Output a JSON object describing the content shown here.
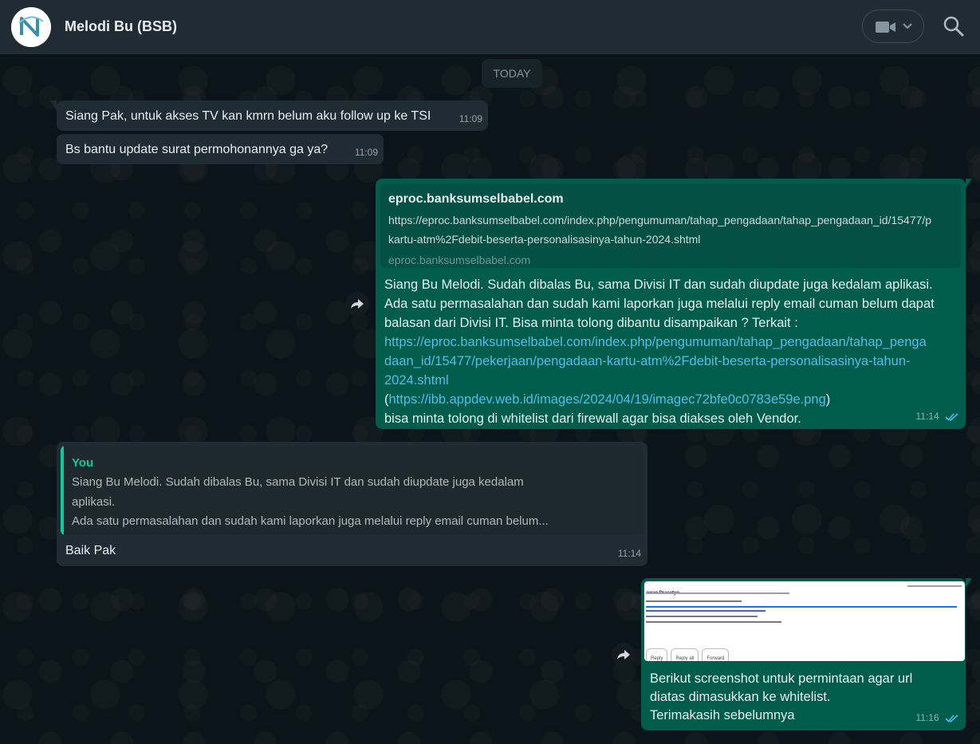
{
  "header": {
    "contact_name": "Melodi Bu (BSB)",
    "avatar_letter": "N"
  },
  "day_divider": "TODAY",
  "messages": [
    {
      "text": "Siang Pak, untuk akses TV kan kmrn belum aku follow up ke TSI",
      "time": "11:09"
    },
    {
      "text": "Bs bantu update surat permohonannya ga ya?",
      "time": "11:09"
    },
    {
      "preview_title": "eproc.banksumselbabel.com",
      "preview_url_1": "https://eproc.banksumselbabel.com/index.php/pengumuman/tahap_pengadaan/tahap_pengadaan_id/15477/p",
      "preview_url_2": "kartu-atm%2Fdebit-beserta-personalisasinya-tahun-2024.shtml",
      "preview_domain": "eproc.banksumselbabel.com",
      "line1": "Siang Bu Melodi. Sudah dibalas Bu, sama Divisi IT dan sudah diupdate juga kedalam aplikasi.",
      "line2": "Ada satu permasalahan dan sudah kami laporkan juga melalui reply email cuman belum dapat",
      "line3": "balasan dari Divisi IT. Bisa minta tolong dibantu disampaikan ? Terkait :",
      "link1_a": "https://eproc.banksumselbabel.com/index.php/pengumuman/tahap_pengadaan/tahap_penga",
      "link1_b": "daan_id/15477/pekerjaan/pengadaan-kartu-atm%2Fdebit-beserta-personalisasinya-tahun-",
      "link1_c": "2024.shtml",
      "paren_open": "(",
      "link2": "https://ibb.appdev.web.id/images/2024/04/19/imagec72bfe0c0783e59e.png",
      "paren_close": ")",
      "line_last": "bisa minta tolong di whitelist dari firewall agar bisa diakses oleh Vendor.",
      "time": "11:14"
    },
    {
      "quote_author": "You",
      "quote_line1": "Siang Bu Melodi. Sudah dibalas Bu, sama Divisi IT dan sudah diupdate juga kedalam",
      "quote_line2": "aplikasi.",
      "quote_line3": "Ada satu permasalahan dan sudah kami laporkan juga melalui reply email cuman belum...",
      "text": "Baik Pak",
      "time": "11:14"
    },
    {
      "image_sender": "awan Prasetyo",
      "image_buttons": [
        "Reply",
        "Reply all",
        "Forward"
      ],
      "line1": "Berikut screenshot untuk permintaan agar url",
      "line2": "diatas dimasukkan ke whitelist.",
      "line3": "Terimakasih sebelumnya",
      "time": "11:16"
    }
  ],
  "colors": {
    "app_bg": "#0b141a",
    "header_bg": "#202c33",
    "incoming_bubble": "#202c33",
    "outgoing_bubble": "#005c4b",
    "link": "#53bdeb",
    "quote_accent": "#06cf9c",
    "read_ticks": "#53bdeb"
  },
  "icons": {
    "call": "video-camera-icon",
    "call_dropdown": "chevron-down-icon",
    "search": "search-icon",
    "forward": "forward-icon",
    "read_receipt": "double-check-icon"
  }
}
